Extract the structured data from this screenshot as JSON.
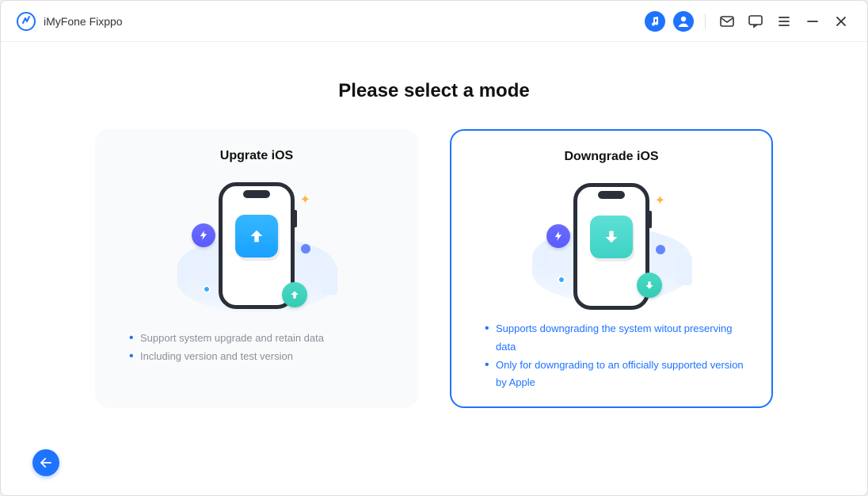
{
  "header": {
    "app_title": "iMyFone Fixppo"
  },
  "main": {
    "title": "Please select a mode",
    "cards": [
      {
        "title": "Upgrate iOS",
        "features": [
          "Support system upgrade and retain data",
          "Including version and test version"
        ]
      },
      {
        "title": "Downgrade iOS",
        "features": [
          "Supports downgrading the system witout preserving data",
          "Only for downgrading to an officially supported version by Apple"
        ]
      }
    ]
  }
}
